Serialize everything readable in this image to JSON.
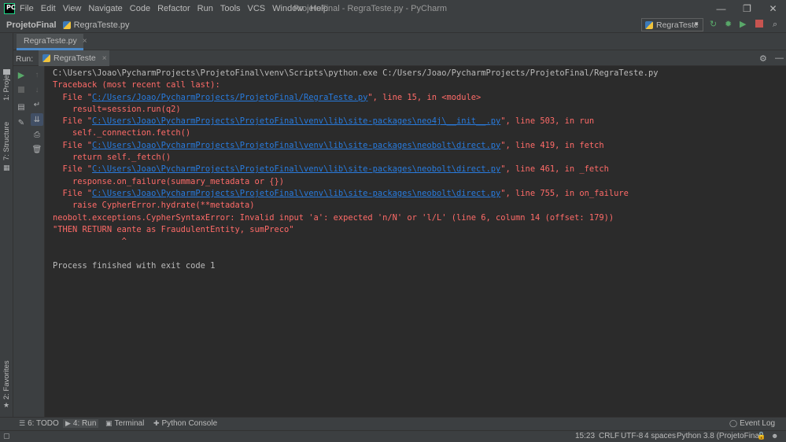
{
  "app": {
    "logo_text": "PC",
    "window_title": "ProjetoFinal - RegraTeste.py - PyCharm",
    "menu": [
      "File",
      "Edit",
      "View",
      "Navigate",
      "Code",
      "Refactor",
      "Run",
      "Tools",
      "VCS",
      "Window",
      "Help"
    ],
    "window_controls": {
      "minimize": "—",
      "maximize": "❐",
      "close": "✕"
    }
  },
  "navbar": {
    "project": "ProjetoFinal",
    "file": "RegraTeste.py",
    "run_config": "RegraTeste"
  },
  "editor_tabs": [
    {
      "label": "RegraTeste.py",
      "close": "×"
    }
  ],
  "left_stripe": {
    "project": "1: Project",
    "structure": "7: Structure",
    "favorites": "2: Favorites"
  },
  "run_window": {
    "label": "Run:",
    "tab": "RegraTeste",
    "close": "×"
  },
  "console": {
    "lines": [
      {
        "type": "plain",
        "text": "C:\\Users\\Joao\\PycharmProjects\\ProjetoFinal\\venv\\Scripts\\python.exe C:/Users/Joao/PycharmProjects/ProjetoFinal/RegraTeste.py"
      },
      {
        "type": "error",
        "text": "Traceback (most recent call last):"
      },
      {
        "type": "link",
        "pre": "  File \"",
        "link": "C:/Users/Joao/PycharmProjects/ProjetoFinal/RegraTeste.py",
        "post": "\", line 15, in <module>"
      },
      {
        "type": "error",
        "text": "    result=session.run(q2)"
      },
      {
        "type": "link",
        "pre": "  File \"",
        "link": "C:\\Users\\Joao\\PycharmProjects\\ProjetoFinal\\venv\\lib\\site-packages\\neo4j\\__init__.py",
        "post": "\", line 503, in run"
      },
      {
        "type": "error",
        "text": "    self._connection.fetch()"
      },
      {
        "type": "link",
        "pre": "  File \"",
        "link": "C:\\Users\\Joao\\PycharmProjects\\ProjetoFinal\\venv\\lib\\site-packages\\neobolt\\direct.py",
        "post": "\", line 419, in fetch"
      },
      {
        "type": "error",
        "text": "    return self._fetch()"
      },
      {
        "type": "link",
        "pre": "  File \"",
        "link": "C:\\Users\\Joao\\PycharmProjects\\ProjetoFinal\\venv\\lib\\site-packages\\neobolt\\direct.py",
        "post": "\", line 461, in _fetch"
      },
      {
        "type": "error",
        "text": "    response.on_failure(summary_metadata or {})"
      },
      {
        "type": "link",
        "pre": "  File \"",
        "link": "C:\\Users\\Joao\\PycharmProjects\\ProjetoFinal\\venv\\lib\\site-packages\\neobolt\\direct.py",
        "post": "\", line 755, in on_failure"
      },
      {
        "type": "error",
        "text": "    raise CypherError.hydrate(**metadata)"
      },
      {
        "type": "error",
        "text": "neobolt.exceptions.CypherSyntaxError: Invalid input 'a': expected 'n/N' or 'l/L' (line 6, column 14 (offset: 179))"
      },
      {
        "type": "error",
        "text": "\"THEN RETURN eante as FraudulentEntity, sumPreco\""
      },
      {
        "type": "error",
        "text": "              ^"
      },
      {
        "type": "plain",
        "text": ""
      },
      {
        "type": "plain",
        "text": "Process finished with exit code 1"
      }
    ]
  },
  "bottom_bar": {
    "todo": "6: TODO",
    "run": "4: Run",
    "terminal": "Terminal",
    "python_console": "Python Console",
    "event_log": "Event Log"
  },
  "status_bar": {
    "position": "15:23",
    "line_separator": "CRLF",
    "encoding": "UTF-8",
    "indent": "4 spaces",
    "interpreter": "Python 3.8 (ProjetoFinal)"
  },
  "colors": {
    "error": "#ff6b68",
    "link": "#287bde",
    "plain": "#bbbbbb",
    "background": "#2b2b2b",
    "chrome": "#3c3f41"
  }
}
